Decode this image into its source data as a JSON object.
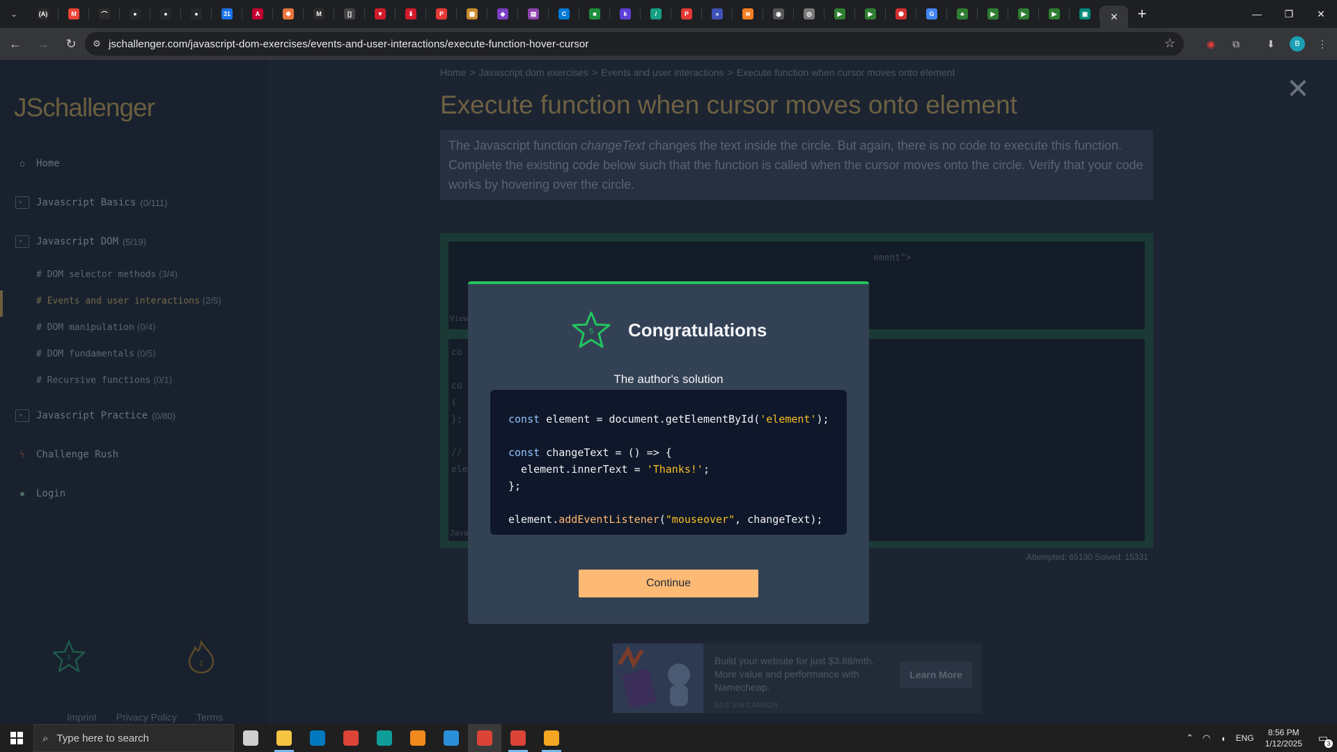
{
  "browser": {
    "url": "jschallenger.com/javascript-dom-exercises/events-and-user-interactions/execute-function-hover-cursor",
    "tab_favicons": [
      {
        "name": "tab-favicon-1",
        "glyph": "(A)",
        "color": "#2b2b2b"
      },
      {
        "name": "tab-favicon-gmail",
        "glyph": "M",
        "color": "#ea4335"
      },
      {
        "name": "tab-favicon-3",
        "glyph": "⌒",
        "color": "#2b2b2b"
      },
      {
        "name": "tab-favicon-github-1",
        "glyph": "●",
        "color": "#24292e"
      },
      {
        "name": "tab-favicon-github-2",
        "glyph": "●",
        "color": "#24292e"
      },
      {
        "name": "tab-favicon-github-3",
        "glyph": "●",
        "color": "#24292e"
      },
      {
        "name": "tab-favicon-calendar",
        "glyph": "31",
        "color": "#1a73e8"
      },
      {
        "name": "tab-favicon-angular",
        "glyph": "A",
        "color": "#c3002f"
      },
      {
        "name": "tab-favicon-asterisk",
        "glyph": "✱",
        "color": "#e8743b"
      },
      {
        "name": "tab-favicon-m",
        "glyph": "M",
        "color": "#2b2b2b"
      },
      {
        "name": "tab-favicon-bracket",
        "glyph": "[]",
        "color": "#444"
      },
      {
        "name": "tab-favicon-red-1",
        "glyph": "▼",
        "color": "#d11a2a"
      },
      {
        "name": "tab-favicon-red-2",
        "glyph": "⬇",
        "color": "#d11a2a"
      },
      {
        "name": "tab-favicon-p-1",
        "glyph": "P",
        "color": "#e53935"
      },
      {
        "name": "tab-favicon-img",
        "glyph": "▦",
        "color": "#c98a2e"
      },
      {
        "name": "tab-favicon-purple",
        "glyph": "◆",
        "color": "#7b3fc4"
      },
      {
        "name": "tab-favicon-media",
        "glyph": "▤",
        "color": "#8e44ad"
      },
      {
        "name": "tab-favicon-c",
        "glyph": "C",
        "color": "#0078d4"
      },
      {
        "name": "tab-favicon-green",
        "glyph": "■",
        "color": "#1e8e3e"
      },
      {
        "name": "tab-favicon-k",
        "glyph": "k",
        "color": "#5b3fd6"
      },
      {
        "name": "tab-favicon-slash",
        "glyph": "/",
        "color": "#16a085"
      },
      {
        "name": "tab-favicon-p-2",
        "glyph": "P",
        "color": "#e53935"
      },
      {
        "name": "tab-favicon-arrows",
        "glyph": "»",
        "color": "#3f51b5"
      },
      {
        "name": "tab-favicon-stack",
        "glyph": "≋",
        "color": "#f48024"
      },
      {
        "name": "tab-favicon-ghost",
        "glyph": "◉",
        "color": "#555"
      },
      {
        "name": "tab-favicon-globe",
        "glyph": "◎",
        "color": "#777"
      },
      {
        "name": "tab-favicon-play-1",
        "glyph": "▶",
        "color": "#2e7d32"
      },
      {
        "name": "tab-favicon-play-2",
        "glyph": "▶",
        "color": "#2e7d32"
      },
      {
        "name": "tab-favicon-hex",
        "glyph": "⬢",
        "color": "#d32f2f"
      },
      {
        "name": "tab-favicon-google",
        "glyph": "G",
        "color": "#4285f4"
      },
      {
        "name": "tab-favicon-tree",
        "glyph": "♣",
        "color": "#2e7d32"
      },
      {
        "name": "tab-favicon-play-3",
        "glyph": "▶",
        "color": "#2e7d32"
      },
      {
        "name": "tab-favicon-play-4",
        "glyph": "▶",
        "color": "#2e7d32"
      },
      {
        "name": "tab-favicon-play-5",
        "glyph": "▶",
        "color": "#2e7d32"
      },
      {
        "name": "tab-favicon-meet",
        "glyph": "▣",
        "color": "#00897b"
      }
    ],
    "active_tab_close": "✕",
    "new_tab": "+",
    "avatar_letter": "B"
  },
  "sidebar": {
    "logo_js": "JS",
    "logo_rest": "challenger",
    "nav": [
      {
        "icon": "home-icon",
        "glyph": "⌂",
        "label": "Home",
        "count": ""
      },
      {
        "icon": "terminal-icon",
        "glyph": ">_",
        "label": "Javascript Basics",
        "count": "(0/111)"
      },
      {
        "icon": "terminal-icon",
        "glyph": ">_",
        "label": "Javascript DOM",
        "count": "(5/19)"
      }
    ],
    "sub": [
      {
        "label": "# DOM selector methods",
        "count": "(3/4)"
      },
      {
        "label": "# Events and user interactions",
        "count": "(2/5)"
      },
      {
        "label": "# DOM manipulation",
        "count": "(0/4)"
      },
      {
        "label": "# DOM fundamentals",
        "count": "(0/5)"
      },
      {
        "label": "# Recursive functions",
        "count": "(0/1)"
      }
    ],
    "nav2": [
      {
        "icon": "terminal-icon",
        "glyph": ">_",
        "label": "Javascript Practice",
        "count": "(0/80)"
      },
      {
        "icon": "lightning-icon",
        "glyph": "ϟ",
        "label": "Challenge Rush",
        "count": ""
      },
      {
        "icon": "user-icon",
        "glyph": "●",
        "label": "Login",
        "count": ""
      }
    ],
    "star_count": "5",
    "streak_count": "1",
    "footer": [
      "Imprint",
      "Privacy Policy",
      "Terms"
    ]
  },
  "main": {
    "breadcrumb": [
      "Home",
      "Javascript dom exercises",
      "Events and user interactions",
      "Execute function when cursor moves onto element"
    ],
    "breadcrumb_sep": ">",
    "title": "Execute function when cursor moves onto element",
    "desc_before": "The Javascript function ",
    "desc_fn": "changeText",
    "desc_after": " changes the text inside the circle. But again, there is no code to execute this function. Complete the existing code below such that the function is called when the cursor moves onto the circle. Verify that your code works by hovering over the circle.",
    "editor_fragments": {
      "top_right": "ement\">",
      "view_label": "View",
      "lines": [
        "co",
        "co",
        "  (",
        "};",
        "//",
        "ele"
      ],
      "bottom_label": "Java"
    },
    "stats": "Attempted: 65130   Solved: 15331",
    "ad": {
      "text": "Build your website for just $3.88/mth. More value and performance with Namecheap.",
      "button": "Learn More",
      "via": "ADS VIA CARBON"
    },
    "close_glyph": "✕"
  },
  "modal": {
    "star_number": "5",
    "title": "Congratulations",
    "solution_label": "The author's solution",
    "code": {
      "l1_kw": "const",
      "l1_rest": " element = document.getElementById(",
      "l1_str": "'element'",
      "l1_end": ");",
      "l3_kw": "const",
      "l3_rest": " changeText = () => {",
      "l4_rest": "  element.innerText = ",
      "l4_str": "'Thanks!'",
      "l4_end": ";",
      "l5": "};",
      "l7_a": "element.",
      "l7_fn": "addEventListener",
      "l7_b": "(",
      "l7_str": "\"mouseover\"",
      "l7_end": ", changeText);"
    },
    "continue": "Continue"
  },
  "taskbar": {
    "search_placeholder": "Type here to search",
    "apps": [
      {
        "name": "task-view-icon",
        "color": "#cfcfcf",
        "state": ""
      },
      {
        "name": "file-explorer-icon",
        "color": "#f5c542",
        "state": "open"
      },
      {
        "name": "trello-icon",
        "color": "#0079bf",
        "state": ""
      },
      {
        "name": "chrome-icon",
        "color": "#db4437",
        "state": ""
      },
      {
        "name": "edge-icon",
        "color": "#0f9d9a",
        "state": ""
      },
      {
        "name": "vlc-icon",
        "color": "#f08a1c",
        "state": ""
      },
      {
        "name": "vscode-icon",
        "color": "#2a8fd6",
        "state": ""
      },
      {
        "name": "chrome-profile-1-icon",
        "color": "#db4437",
        "state": "running"
      },
      {
        "name": "chrome-profile-2-icon",
        "color": "#db4437",
        "state": "open"
      },
      {
        "name": "files-icon",
        "color": "#f5a623",
        "state": "open"
      }
    ],
    "lang": "ENG",
    "time": "8:56 PM",
    "date": "1/12/2025",
    "notif_count": "3"
  }
}
